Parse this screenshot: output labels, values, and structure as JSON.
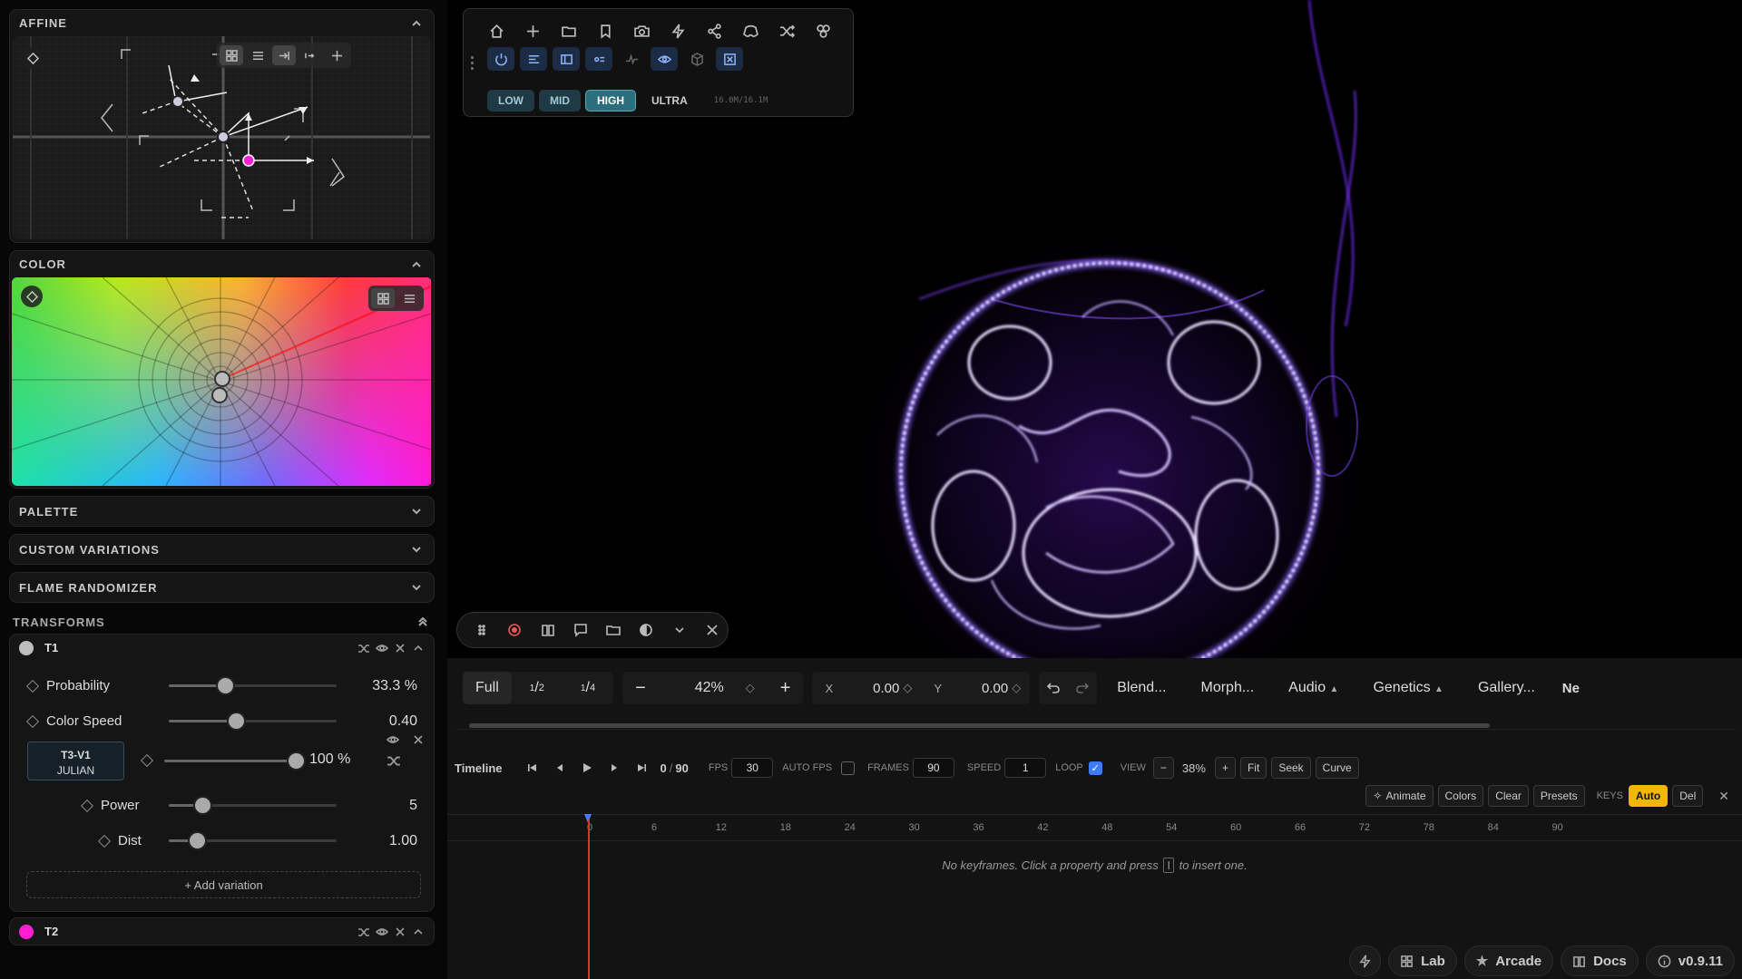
{
  "left": {
    "affine": {
      "title": "AFFINE"
    },
    "color": {
      "title": "COLOR"
    },
    "collapsed": [
      {
        "title": "PALETTE"
      },
      {
        "title": "CUSTOM VARIATIONS"
      },
      {
        "title": "FLAME RANDOMIZER"
      }
    ],
    "transforms": {
      "title": "TRANSFORMS",
      "t1": {
        "name": "T1",
        "color": "#bdbdbd",
        "params": [
          {
            "label": "Probability",
            "value": "33.3 %",
            "fraction": 0.333
          },
          {
            "label": "Color Speed",
            "value": "0.40",
            "fraction": 0.4
          }
        ],
        "variation": {
          "line1": "T3-V1",
          "line2": "JULIAN",
          "value": "100 %",
          "fraction": 1.0
        },
        "var_params": [
          {
            "label": "Power",
            "value": "5",
            "fraction": 0.2
          },
          {
            "label": "Dist",
            "value": "1.00",
            "fraction": 0.17
          }
        ],
        "add_variation": "+ Add variation"
      },
      "t2": {
        "name": "T2",
        "color": "#ff1fd2"
      }
    }
  },
  "toolbar": {
    "quality": [
      "LOW",
      "MID",
      "HIGH",
      "ULTRA"
    ],
    "quality_selected": "HIGH",
    "memory": "16.0M/16.1M"
  },
  "viewbar": {
    "res": [
      "Full",
      "1/2",
      "1/4"
    ],
    "zoom": "42%",
    "x_label": "X",
    "x_value": "0.00",
    "y_label": "Y",
    "y_value": "0.00",
    "menus": [
      "Blend...",
      "Morph...",
      "Audio",
      "Genetics",
      "Gallery...",
      "Ne"
    ]
  },
  "timeline": {
    "label": "Timeline",
    "frame": "0",
    "total": "90",
    "fps_label": "FPS",
    "fps": "30",
    "autofps_label": "AUTO FPS",
    "frames_label": "FRAMES",
    "frames": "90",
    "speed_label": "SPEED",
    "speed": "1",
    "loop_label": "LOOP",
    "view_label": "VIEW",
    "view_zoom": "38%",
    "buttons": [
      "Fit",
      "Seek",
      "Curve"
    ],
    "actions": [
      "Animate",
      "Colors",
      "Clear",
      "Presets"
    ],
    "keys_label": "KEYS",
    "auto": "Auto",
    "del": "Del",
    "ruler": [
      "0",
      "6",
      "12",
      "18",
      "24",
      "30",
      "36",
      "42",
      "48",
      "54",
      "60",
      "66",
      "72",
      "78",
      "84",
      "90"
    ],
    "empty_pre": "No keyframes. Click a property and press",
    "empty_key": "I",
    "empty_post": "to insert one."
  },
  "footer": {
    "lab": "Lab",
    "arcade": "Arcade",
    "docs": "Docs",
    "version": "v0.9.11"
  }
}
